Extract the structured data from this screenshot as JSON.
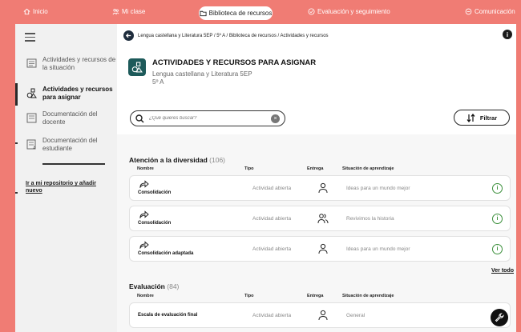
{
  "topnav": {
    "items": [
      {
        "label": "Inicio",
        "icon": "home-icon"
      },
      {
        "label": "Mi clase",
        "icon": "people-icon"
      },
      {
        "label": "Biblioteca de recursos",
        "icon": "folder-icon",
        "active": true
      },
      {
        "label": "Evaluación y seguimiento",
        "icon": "check-circle-icon"
      },
      {
        "label": "Comunicación",
        "icon": "chat-icon"
      }
    ]
  },
  "sidebar": {
    "items": [
      {
        "label": "Actividades y recursos de la situación",
        "icon": "activities-icon"
      },
      {
        "label": "Actividades y recursos para asignar",
        "icon": "shapes-icon",
        "active": true
      },
      {
        "label": "Documentación del docente",
        "icon": "document-icon"
      },
      {
        "label": "Documentación del estudiante",
        "icon": "student-doc-icon"
      }
    ],
    "link": "Ir a mi repositorio y añadir nuevo"
  },
  "breadcrumb": "Lengua castellana y Literatura 5EP  /  5º A  /  Biblioteca de recursos  /  Actividades y recursos",
  "header": {
    "title": "ACTIVIDADES Y RECURSOS PARA ASIGNAR",
    "subject": "Lengua castellana y Literatura 5EP",
    "group": "5º A"
  },
  "search": {
    "placeholder": "¿Qué quieres buscar?"
  },
  "filter": {
    "label": "Filtrar"
  },
  "columns": {
    "nombre": "Nombre",
    "tipo": "Tipo",
    "entrega": "Entrega",
    "situacion": "Situación de aprendizaje"
  },
  "sections": [
    {
      "title": "Atención a la diversidad",
      "count": "(106)",
      "rows": [
        {
          "name": "Consolidación",
          "tipo": "Actividad abierta",
          "entrega": "individual",
          "situacion": "Ideas para un mundo mejor"
        },
        {
          "name": "Consolidación",
          "tipo": "Actividad abierta",
          "entrega": "grupal",
          "situacion": "Revivimos la historia"
        },
        {
          "name": "Consolidación adaptada",
          "tipo": "Actividad abierta",
          "entrega": "individual",
          "situacion": "Ideas para un mundo mejor"
        }
      ],
      "more": "Ver todo"
    },
    {
      "title": "Evaluación",
      "count": "(84)",
      "rows": [
        {
          "name": "Escala de evaluación final",
          "tipo": "Actividad abierta",
          "entrega": "individual",
          "situacion": "General"
        }
      ]
    }
  ],
  "colors": {
    "background": "#f07c74",
    "accent": "#1d5a5a",
    "info_green": "#3a8f3a"
  }
}
